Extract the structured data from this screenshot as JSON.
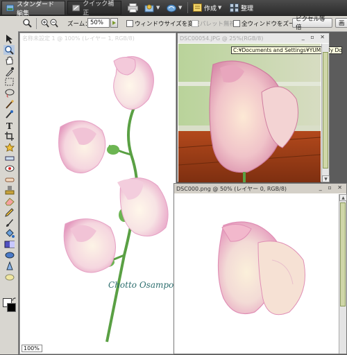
{
  "modebar": {
    "tabs": [
      {
        "label": "スタンダード編集",
        "icon": "edit-mode-icon",
        "active": true
      },
      {
        "label": "クイック補正",
        "icon": "quick-fix-icon",
        "active": false
      }
    ],
    "tools": [
      {
        "icon": "print-icon"
      },
      {
        "icon": "share-icon"
      },
      {
        "icon": "online-icon"
      }
    ],
    "create_label": "作成",
    "organize_label": "整理"
  },
  "options": {
    "zoom_label": "ズーム：",
    "zoom_value": "50%",
    "resize_windows": "ウィンドウサイズを変更",
    "ignore_palettes": "パレット無視",
    "zoom_all": "全ウィンドウをズーム",
    "actual_pixels": "ピクセル等倍",
    "fit_screen": "画"
  },
  "toolbox": {
    "tools": [
      "move-tool-icon",
      "zoom-tool-icon",
      "hand-tool-icon",
      "eyedropper-icon",
      "marquee-icon",
      "lasso-icon",
      "magic-wand-icon",
      "selection-brush-icon",
      "type-tool-icon",
      "crop-icon",
      "cookie-cutter-icon",
      "straighten-icon",
      "red-eye-icon",
      "healing-brush-icon",
      "clone-stamp-icon",
      "eraser-icon",
      "pencil-icon",
      "brush-icon",
      "paint-bucket-icon",
      "gradient-icon",
      "shape-icon",
      "blur-icon",
      "sponge-icon"
    ]
  },
  "docs": {
    "left": {
      "title": "名称未設定 1 @ 100% (レイヤー 1, RGB/8)",
      "zoom": "100%",
      "watermark": "Chotto Osampo Koubou"
    },
    "upper_right": {
      "title": "DSC00054.JPG @ 25%(RGB/8)",
      "tooltip": "C:¥Documents and Settings¥YUMI¥My Docum"
    },
    "lower_right": {
      "title": "DSC000.png @ 50% (レイヤー 0, RGB/8)"
    }
  },
  "colors": {
    "accent_pink": "#e9a7c9",
    "stem_green": "#5aa044",
    "watermark_teal": "#2d6e6e"
  }
}
